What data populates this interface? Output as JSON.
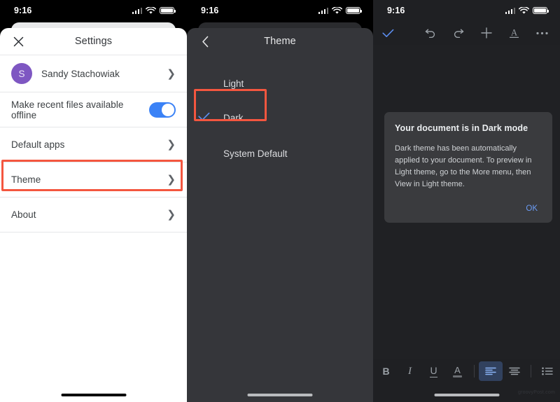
{
  "status_bar": {
    "time": "9:16"
  },
  "panel_settings": {
    "title": "Settings",
    "close_icon": "close-icon",
    "account": {
      "initial": "S",
      "name": "Sandy Stachowiak"
    },
    "rows": [
      {
        "label": "Make recent files available offline",
        "control": "toggle",
        "value": "on"
      },
      {
        "label": "Default apps",
        "control": "chevron"
      },
      {
        "label": "Theme",
        "control": "chevron",
        "highlighted": true
      },
      {
        "label": "About",
        "control": "chevron"
      }
    ]
  },
  "panel_theme": {
    "title": "Theme",
    "back_icon": "back-chevron-icon",
    "options": [
      {
        "label": "Light",
        "selected": false
      },
      {
        "label": "Dark",
        "selected": true,
        "highlighted": true
      },
      {
        "label": "System Default",
        "selected": false
      }
    ]
  },
  "panel_doc": {
    "toolbar": {
      "done_icon": "check-icon",
      "undo_icon": "undo-icon",
      "redo_icon": "redo-icon",
      "add_icon": "plus-icon",
      "text_format_icon": "text-format-icon",
      "more_icon": "more-options-icon"
    },
    "dialog": {
      "title": "Your document is in Dark mode",
      "body": "Dark theme has been automatically applied to your document. To preview in Light theme, go to the More menu, then View in Light theme.",
      "ok_label": "OK"
    },
    "format_bar": [
      {
        "name": "bold",
        "glyph": "B",
        "active": false
      },
      {
        "name": "italic",
        "glyph": "I",
        "active": false
      },
      {
        "name": "underline",
        "glyph": "U",
        "active": false
      },
      {
        "name": "text-color",
        "glyph": "A",
        "active": false
      },
      {
        "name": "align-left",
        "glyph": "",
        "active": true
      },
      {
        "name": "align-center",
        "glyph": "",
        "active": false
      },
      {
        "name": "bulleted-list",
        "glyph": "",
        "active": false
      }
    ],
    "watermark": "groovyPost.com"
  },
  "colors": {
    "accent_blue": "#3b82f6",
    "avatar_purple": "#7e57c2",
    "highlight_red": "#f4563f",
    "dark_sheet": "#35363a",
    "doc_bg": "#202124"
  }
}
